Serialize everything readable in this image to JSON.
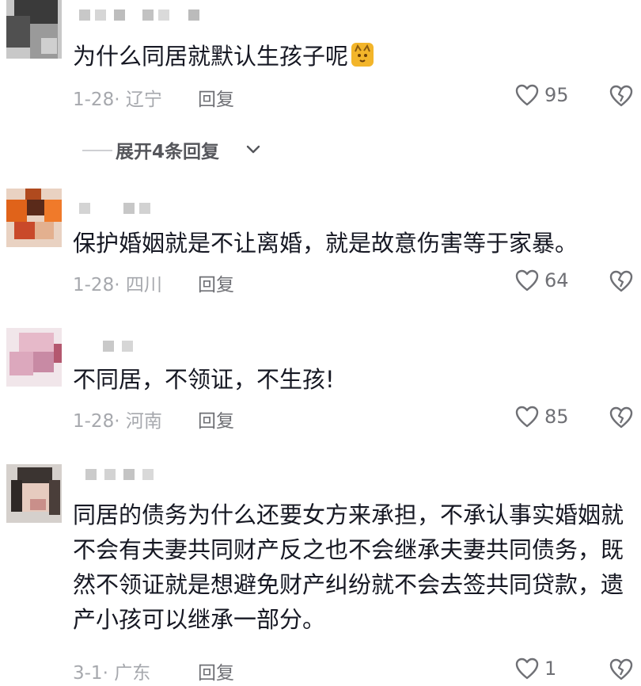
{
  "comments": [
    {
      "text": "为什么同居就默认生孩子呢",
      "date": "1-28",
      "location": "辽宁",
      "reply": "回复",
      "likes": "95",
      "emoji": "cat-face-emoji"
    },
    {
      "text": "保护婚姻就是不让离婚，就是故意伤害等于家暴。",
      "date": "1-28",
      "location": "四川",
      "reply": "回复",
      "likes": "64"
    },
    {
      "text": "不同居，不领证，不生孩!",
      "date": "1-28",
      "location": "河南",
      "reply": "回复",
      "likes": "85"
    },
    {
      "text": "同居的债务为什么还要女方来承担，不承认事实婚姻就不会有夫妻共同财产反之也不会继承夫妻共同债务，既然不领证就是想避免财产纠纷就不会去签共同贷款，遗产小孩可以继承一部分。",
      "date": "3-1",
      "location": "广东",
      "reply": "回复",
      "likes": "1"
    }
  ],
  "expand_replies": "展开4条回复",
  "colors": {
    "text": "#161823",
    "meta": "#a6a8ad",
    "icon": "#6f7075"
  },
  "icons": [
    "heart-outline-icon",
    "broken-heart-icon",
    "chevron-down-icon"
  ]
}
